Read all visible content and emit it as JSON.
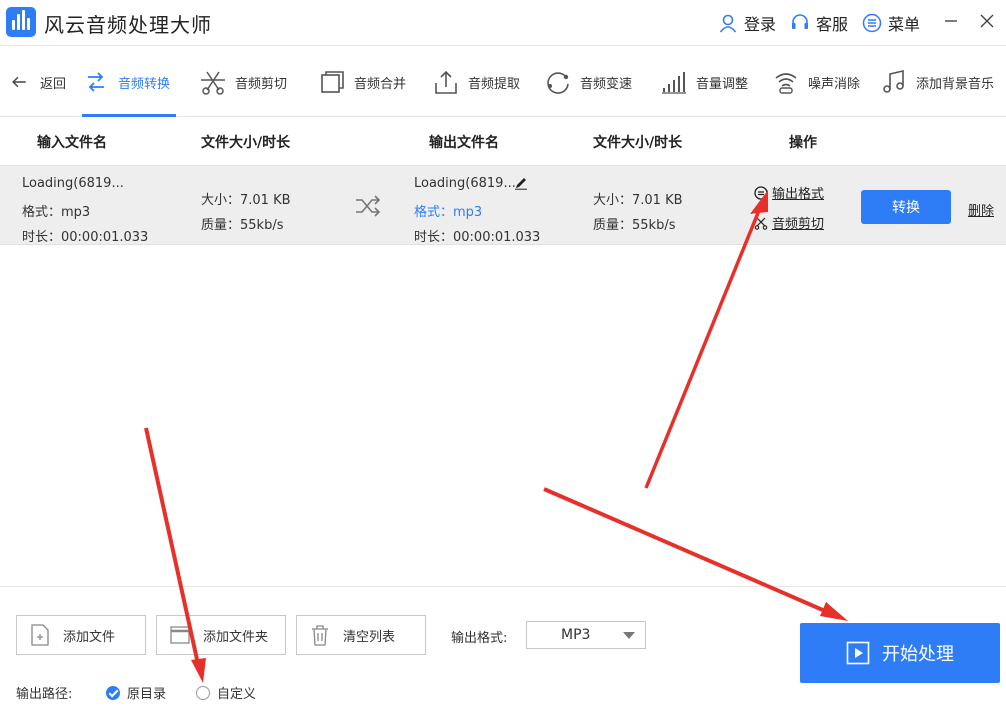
{
  "app": {
    "title": "风云音频处理大师"
  },
  "titlebar": {
    "login": "登录",
    "service": "客服",
    "menu": "菜单"
  },
  "toolbar": {
    "back": "返回",
    "items": [
      {
        "label": "音频转换",
        "icon": "convert-icon",
        "active": true
      },
      {
        "label": "音频剪切",
        "icon": "scissors-icon"
      },
      {
        "label": "音频合并",
        "icon": "merge-icon"
      },
      {
        "label": "音频提取",
        "icon": "extract-icon"
      },
      {
        "label": "音频变速",
        "icon": "speed-icon"
      },
      {
        "label": "音量调整",
        "icon": "volume-bars-icon"
      },
      {
        "label": "噪声消除",
        "icon": "noise-icon"
      },
      {
        "label": "添加背景音乐",
        "icon": "music-note-icon"
      }
    ]
  },
  "table": {
    "headers": [
      "输入文件名",
      "文件大小/时长",
      "输出文件名",
      "文件大小/时长",
      "操作"
    ],
    "row": {
      "input_name": "Loading(6819...",
      "input_format": "格式：mp3",
      "input_duration": "时长：00:00:01.033",
      "input_size": "大小：7.01 KB",
      "input_quality": "质量：55kb/s",
      "output_name": "Loading(6819...",
      "output_format": "格式：mp3",
      "output_duration": "时长：00:00:01.033",
      "output_size": "大小：7.01 KB",
      "output_quality": "质量：55kb/s",
      "action_format": "输出格式",
      "action_cut": "音频剪切",
      "convert": "转换",
      "delete": "删除"
    }
  },
  "bottom": {
    "add_file": "添加文件",
    "add_folder": "添加文件夹",
    "clear_list": "清空列表",
    "format_label": "输出格式:",
    "format_value": "MP3",
    "path_label": "输出路径:",
    "path_original": "原目录",
    "path_custom": "自定义",
    "start": "开始处理"
  },
  "colors": {
    "accent": "#2f7df6",
    "arrow": "#e8302a",
    "row_bg": "#eeeeee"
  }
}
